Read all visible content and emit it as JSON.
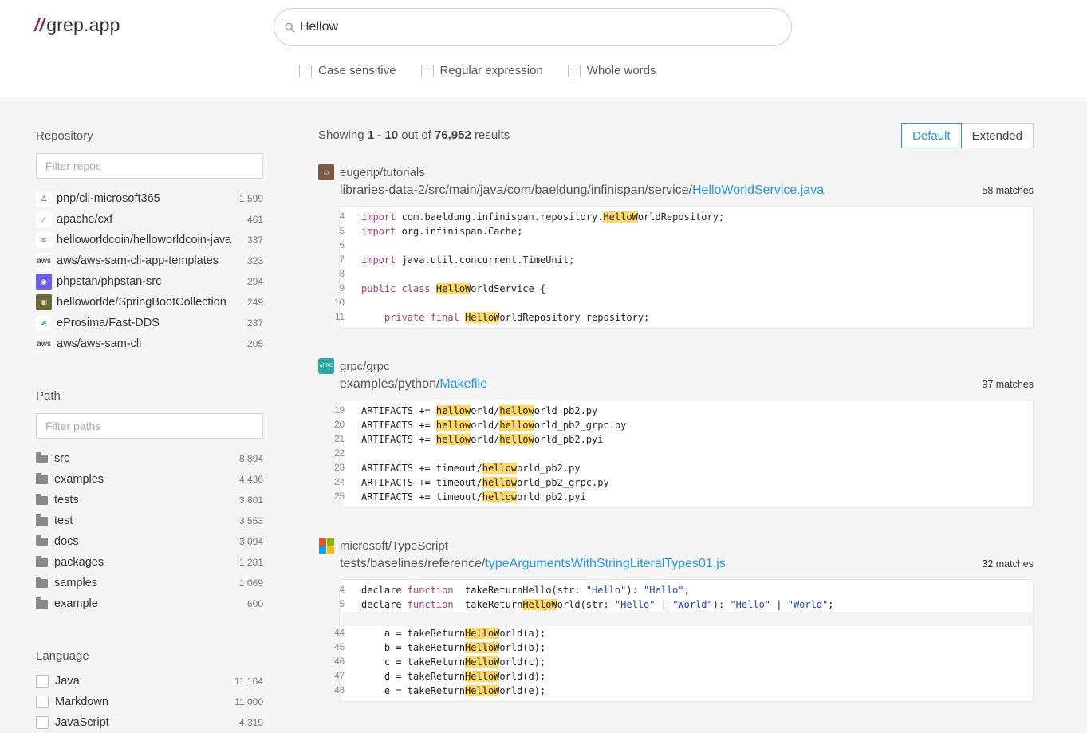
{
  "header": {
    "logo_slashes": "//",
    "logo_text": "grep.app",
    "search_value": "Hellow",
    "options": [
      "Case sensitive",
      "Regular expression",
      "Whole words"
    ]
  },
  "sidebar": {
    "repository": {
      "title": "Repository",
      "placeholder": "Filter repos",
      "items": [
        {
          "name": "pnp/cli-microsoft365",
          "count": "1,599",
          "icon": "pnp-avatar-icon"
        },
        {
          "name": "apache/cxf",
          "count": "461",
          "icon": "apache-feather-icon"
        },
        {
          "name": "helloworldcoin/helloworldcoin-java",
          "count": "337",
          "icon": "helloworldcoin-avatar-icon"
        },
        {
          "name": "aws/aws-sam-cli-app-templates",
          "count": "323",
          "icon": "aws-logo-icon"
        },
        {
          "name": "phpstan/phpstan-src",
          "count": "294",
          "icon": "phpstan-avatar-icon"
        },
        {
          "name": "helloworlde/SpringBootCollection",
          "count": "249",
          "icon": "helloworlde-avatar-icon"
        },
        {
          "name": "eProsima/Fast-DDS",
          "count": "237",
          "icon": "eprosima-logo-icon"
        },
        {
          "name": "aws/aws-sam-cli",
          "count": "205",
          "icon": "aws-logo-icon"
        }
      ]
    },
    "path": {
      "title": "Path",
      "placeholder": "Filter paths",
      "items": [
        {
          "name": "src",
          "count": "8,894"
        },
        {
          "name": "examples",
          "count": "4,436"
        },
        {
          "name": "tests",
          "count": "3,801"
        },
        {
          "name": "test",
          "count": "3,553"
        },
        {
          "name": "docs",
          "count": "3,094"
        },
        {
          "name": "packages",
          "count": "1,281"
        },
        {
          "name": "samples",
          "count": "1,069"
        },
        {
          "name": "example",
          "count": "600"
        }
      ]
    },
    "language": {
      "title": "Language",
      "items": [
        {
          "name": "Java",
          "count": "11,104"
        },
        {
          "name": "Markdown",
          "count": "11,000"
        },
        {
          "name": "JavaScript",
          "count": "4,319"
        }
      ]
    }
  },
  "results": {
    "showing_prefix": "Showing",
    "range": "1 - 10",
    "out_of": "out of",
    "total": "76,952",
    "results_word": "results",
    "view_default": "Default",
    "view_extended": "Extended",
    "items": [
      {
        "repo": "eugenp/tutorials",
        "dir": "libraries-data-2/src/main/java/com/baeldung/infinispan/service/",
        "file": "HelloWorldService.java",
        "matches": "58 matches",
        "lines": [
          {
            "no": "4",
            "parts": [
              [
                "kw",
                "import"
              ],
              [
                "",
                "com.baeldung.infinispan.repository."
              ],
              [
                "hl",
                "HelloW"
              ],
              [
                "",
                "orldRepository;"
              ]
            ]
          },
          {
            "no": "5",
            "parts": [
              [
                "kw",
                "import"
              ],
              [
                "",
                "org.infinispan.Cache;"
              ]
            ]
          },
          {
            "no": "6",
            "parts": []
          },
          {
            "no": "7",
            "parts": [
              [
                "kw",
                "import"
              ],
              [
                "",
                "java.util.concurrent.TimeUnit;"
              ]
            ]
          },
          {
            "no": "8",
            "parts": []
          },
          {
            "no": "9",
            "parts": [
              [
                "kw",
                "public class"
              ],
              [
                "",
                ""
              ],
              [
                "hl",
                "HelloW"
              ],
              [
                "",
                "orldService {"
              ]
            ]
          },
          {
            "no": "10",
            "parts": []
          },
          {
            "no": "11",
            "parts": [
              [
                "",
                "    "
              ],
              [
                "kw",
                "private final"
              ],
              [
                "",
                ""
              ],
              [
                "hl",
                "HelloW"
              ],
              [
                "",
                "orldRepository repository;"
              ]
            ]
          }
        ]
      },
      {
        "repo": "grpc/grpc",
        "dir": "examples/python/",
        "file": "Makefile",
        "matches": "97 matches",
        "lines": [
          {
            "no": "19",
            "parts": [
              [
                "",
                "ARTIFACTS += "
              ],
              [
                "hl",
                "hellow"
              ],
              [
                "",
                "orld/"
              ],
              [
                "hl",
                "hellow"
              ],
              [
                "",
                "orld_pb2.py"
              ]
            ]
          },
          {
            "no": "20",
            "parts": [
              [
                "",
                "ARTIFACTS += "
              ],
              [
                "hl",
                "hellow"
              ],
              [
                "",
                "orld/"
              ],
              [
                "hl",
                "hellow"
              ],
              [
                "",
                "orld_pb2_grpc.py"
              ]
            ]
          },
          {
            "no": "21",
            "parts": [
              [
                "",
                "ARTIFACTS += "
              ],
              [
                "hl",
                "hellow"
              ],
              [
                "",
                "orld/"
              ],
              [
                "hl",
                "hellow"
              ],
              [
                "",
                "orld_pb2.pyi"
              ]
            ]
          },
          {
            "no": "22",
            "parts": []
          },
          {
            "no": "23",
            "parts": [
              [
                "",
                "ARTIFACTS += timeout/"
              ],
              [
                "hl",
                "hellow"
              ],
              [
                "",
                "orld_pb2.py"
              ]
            ]
          },
          {
            "no": "24",
            "parts": [
              [
                "",
                "ARTIFACTS += timeout/"
              ],
              [
                "hl",
                "hellow"
              ],
              [
                "",
                "orld_pb2_grpc.py"
              ]
            ]
          },
          {
            "no": "25",
            "parts": [
              [
                "",
                "ARTIFACTS += timeout/"
              ],
              [
                "hl",
                "hellow"
              ],
              [
                "",
                "orld_pb2.pyi"
              ]
            ]
          }
        ]
      },
      {
        "repo": "microsoft/TypeScript",
        "dir": "tests/baselines/reference/",
        "file": "typeArgumentsWithStringLiteralTypes01.js",
        "matches": "32 matches",
        "lines": [
          {
            "no": "4",
            "parts": [
              [
                "",
                "declare "
              ],
              [
                "kw",
                "function"
              ],
              [
                "",
                " takeReturnHello(str: "
              ],
              [
                "st",
                "\"Hello\""
              ],
              [
                "",
                "): "
              ],
              [
                "st",
                "\"Hello\""
              ],
              [
                "",
                ";"
              ]
            ]
          },
          {
            "no": "5",
            "parts": [
              [
                "",
                "declare "
              ],
              [
                "kw",
                "function"
              ],
              [
                "",
                " takeReturn"
              ],
              [
                "hl",
                "HelloW"
              ],
              [
                "",
                "orld(str: "
              ],
              [
                "st",
                "\"Hello\""
              ],
              [
                "",
                " | "
              ],
              [
                "st",
                "\"World\""
              ],
              [
                "",
                "): "
              ],
              [
                "st",
                "\"Hello\""
              ],
              [
                "",
                " | "
              ],
              [
                "st",
                "\"World\""
              ],
              [
                "",
                ";"
              ]
            ]
          },
          {
            "sep": true
          },
          {
            "no": "44",
            "parts": [
              [
                "",
                "    a = takeReturn"
              ],
              [
                "hl",
                "HelloW"
              ],
              [
                "",
                "orld(a);"
              ]
            ]
          },
          {
            "no": "45",
            "parts": [
              [
                "",
                "    b = takeReturn"
              ],
              [
                "hl",
                "HelloW"
              ],
              [
                "",
                "orld(b);"
              ]
            ]
          },
          {
            "no": "46",
            "parts": [
              [
                "",
                "    c = takeReturn"
              ],
              [
                "hl",
                "HelloW"
              ],
              [
                "",
                "orld(c);"
              ]
            ]
          },
          {
            "no": "47",
            "parts": [
              [
                "",
                "    d = takeReturn"
              ],
              [
                "hl",
                "HelloW"
              ],
              [
                "",
                "orld(d);"
              ]
            ]
          },
          {
            "no": "48",
            "parts": [
              [
                "",
                "    e = takeReturn"
              ],
              [
                "hl",
                "HelloW"
              ],
              [
                "",
                "orld(e);"
              ]
            ]
          }
        ]
      }
    ]
  },
  "colors": {
    "accent": "#2196f3",
    "highlight": "#ffd966",
    "keyword": "#a23a7a",
    "logo_slash": "#8b2a6b"
  }
}
